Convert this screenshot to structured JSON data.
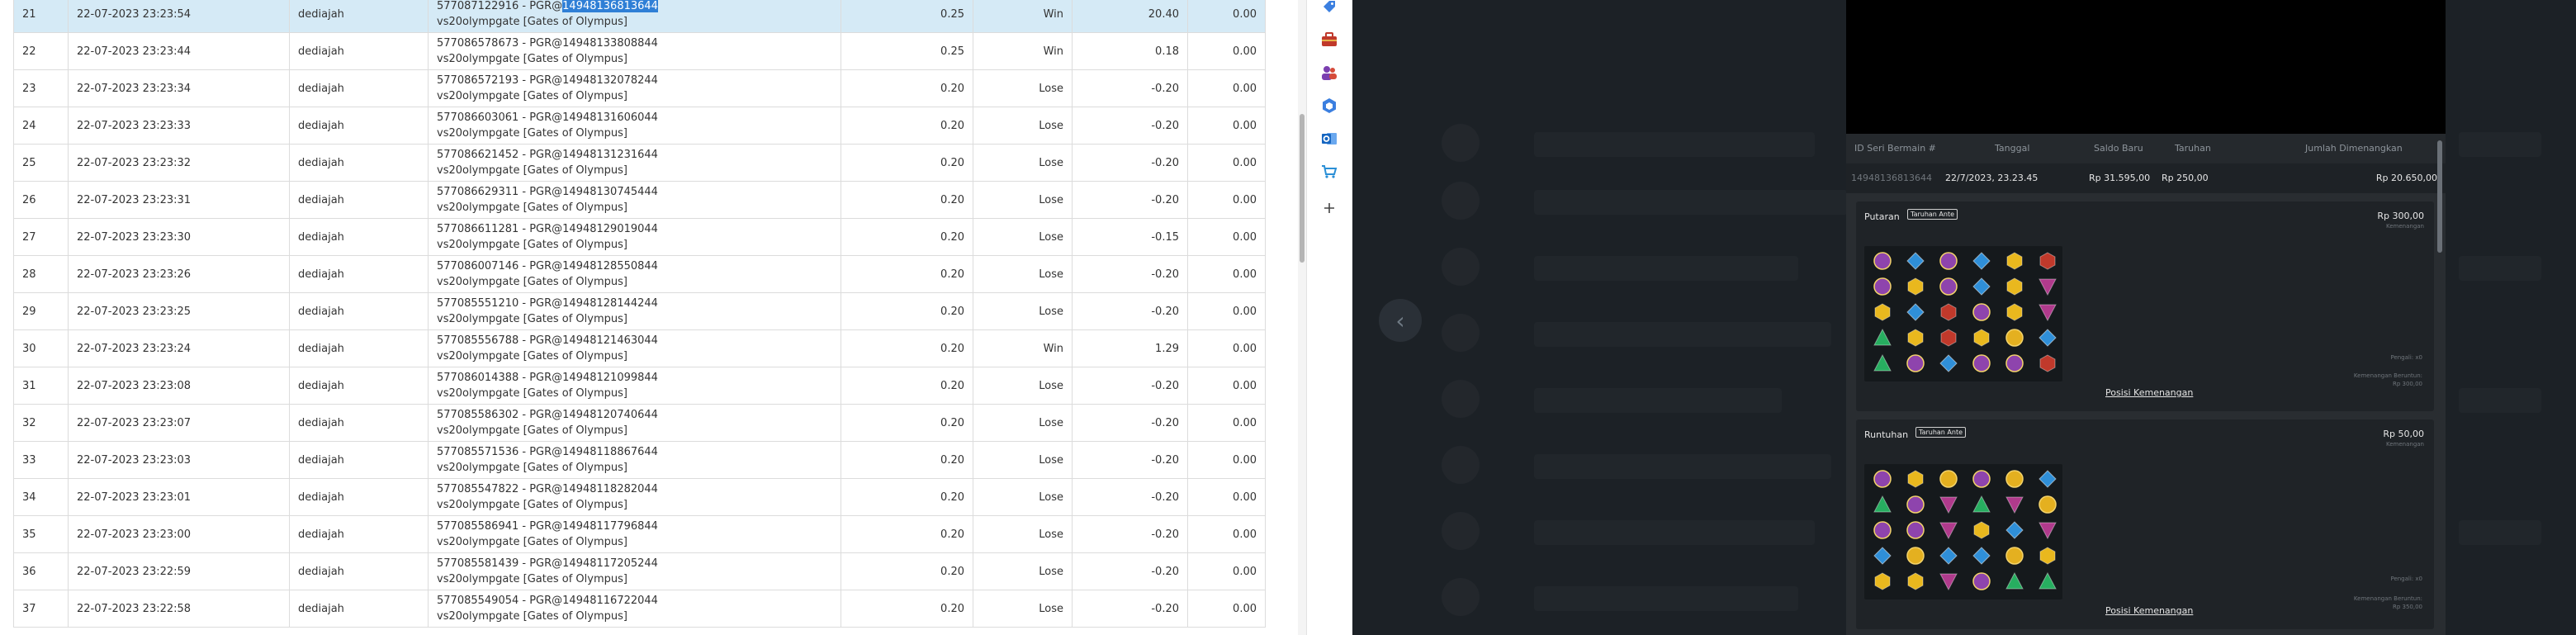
{
  "table": {
    "rows": [
      {
        "no": "21",
        "datetime": "22-07-2023 23:23:54",
        "user": "dediajah",
        "tx_prefix": "577087122916 - PGR@",
        "tx_highlight": "14948136813644",
        "game": "vs20olympgate [Gates of Olympus]",
        "bet": "0.25",
        "result": "Win",
        "win": "20.40",
        "extra": "0.00",
        "selected": true
      },
      {
        "no": "22",
        "datetime": "22-07-2023 23:23:44",
        "user": "dediajah",
        "tx_prefix": "577086578673 - PGR@14948133808844",
        "tx_highlight": "",
        "game": "vs20olympgate [Gates of Olympus]",
        "bet": "0.25",
        "result": "Win",
        "win": "0.18",
        "extra": "0.00"
      },
      {
        "no": "23",
        "datetime": "22-07-2023 23:23:34",
        "user": "dediajah",
        "tx_prefix": "577086572193 - PGR@14948132078244",
        "tx_highlight": "",
        "game": "vs20olympgate [Gates of Olympus]",
        "bet": "0.20",
        "result": "Lose",
        "win": "-0.20",
        "extra": "0.00"
      },
      {
        "no": "24",
        "datetime": "22-07-2023 23:23:33",
        "user": "dediajah",
        "tx_prefix": "577086603061 - PGR@14948131606044",
        "tx_highlight": "",
        "game": "vs20olympgate [Gates of Olympus]",
        "bet": "0.20",
        "result": "Lose",
        "win": "-0.20",
        "extra": "0.00"
      },
      {
        "no": "25",
        "datetime": "22-07-2023 23:23:32",
        "user": "dediajah",
        "tx_prefix": "577086621452 - PGR@14948131231644",
        "tx_highlight": "",
        "game": "vs20olympgate [Gates of Olympus]",
        "bet": "0.20",
        "result": "Lose",
        "win": "-0.20",
        "extra": "0.00"
      },
      {
        "no": "26",
        "datetime": "22-07-2023 23:23:31",
        "user": "dediajah",
        "tx_prefix": "577086629311 - PGR@14948130745444",
        "tx_highlight": "",
        "game": "vs20olympgate [Gates of Olympus]",
        "bet": "0.20",
        "result": "Lose",
        "win": "-0.20",
        "extra": "0.00"
      },
      {
        "no": "27",
        "datetime": "22-07-2023 23:23:30",
        "user": "dediajah",
        "tx_prefix": "577086611281 - PGR@14948129019044",
        "tx_highlight": "",
        "game": "vs20olympgate [Gates of Olympus]",
        "bet": "0.20",
        "result": "Lose",
        "win": "-0.15",
        "extra": "0.00"
      },
      {
        "no": "28",
        "datetime": "22-07-2023 23:23:26",
        "user": "dediajah",
        "tx_prefix": "577086007146 - PGR@14948128550844",
        "tx_highlight": "",
        "game": "vs20olympgate [Gates of Olympus]",
        "bet": "0.20",
        "result": "Lose",
        "win": "-0.20",
        "extra": "0.00"
      },
      {
        "no": "29",
        "datetime": "22-07-2023 23:23:25",
        "user": "dediajah",
        "tx_prefix": "577085551210 - PGR@14948128144244",
        "tx_highlight": "",
        "game": "vs20olympgate [Gates of Olympus]",
        "bet": "0.20",
        "result": "Lose",
        "win": "-0.20",
        "extra": "0.00"
      },
      {
        "no": "30",
        "datetime": "22-07-2023 23:23:24",
        "user": "dediajah",
        "tx_prefix": "577085556788 - PGR@14948121463044",
        "tx_highlight": "",
        "game": "vs20olympgate [Gates of Olympus]",
        "bet": "0.20",
        "result": "Win",
        "win": "1.29",
        "extra": "0.00"
      },
      {
        "no": "31",
        "datetime": "22-07-2023 23:23:08",
        "user": "dediajah",
        "tx_prefix": "577086014388 - PGR@14948121099844",
        "tx_highlight": "",
        "game": "vs20olympgate [Gates of Olympus]",
        "bet": "0.20",
        "result": "Lose",
        "win": "-0.20",
        "extra": "0.00"
      },
      {
        "no": "32",
        "datetime": "22-07-2023 23:23:07",
        "user": "dediajah",
        "tx_prefix": "577085586302 - PGR@14948120740644",
        "tx_highlight": "",
        "game": "vs20olympgate [Gates of Olympus]",
        "bet": "0.20",
        "result": "Lose",
        "win": "-0.20",
        "extra": "0.00"
      },
      {
        "no": "33",
        "datetime": "22-07-2023 23:23:03",
        "user": "dediajah",
        "tx_prefix": "577085571536 - PGR@14948118867644",
        "tx_highlight": "",
        "game": "vs20olympgate [Gates of Olympus]",
        "bet": "0.20",
        "result": "Lose",
        "win": "-0.20",
        "extra": "0.00"
      },
      {
        "no": "34",
        "datetime": "22-07-2023 23:23:01",
        "user": "dediajah",
        "tx_prefix": "577085547822 - PGR@14948118282044",
        "tx_highlight": "",
        "game": "vs20olympgate [Gates of Olympus]",
        "bet": "0.20",
        "result": "Lose",
        "win": "-0.20",
        "extra": "0.00"
      },
      {
        "no": "35",
        "datetime": "22-07-2023 23:23:00",
        "user": "dediajah",
        "tx_prefix": "577085586941 - PGR@14948117796844",
        "tx_highlight": "",
        "game": "vs20olympgate [Gates of Olympus]",
        "bet": "0.20",
        "result": "Lose",
        "win": "-0.20",
        "extra": "0.00"
      },
      {
        "no": "36",
        "datetime": "22-07-2023 23:22:59",
        "user": "dediajah",
        "tx_prefix": "577085581439 - PGR@14948117205244",
        "tx_highlight": "",
        "game": "vs20olympgate [Gates of Olympus]",
        "bet": "0.20",
        "result": "Lose",
        "win": "-0.20",
        "extra": "0.00"
      },
      {
        "no": "37",
        "datetime": "22-07-2023 23:22:58",
        "user": "dediajah",
        "tx_prefix": "577085549054 - PGR@14948116722044",
        "tx_highlight": "",
        "game": "vs20olympgate [Gates of Olympus]",
        "bet": "0.20",
        "result": "Lose",
        "win": "-0.20",
        "extra": "0.00"
      }
    ]
  },
  "sidebar_icons": [
    "tag-icon",
    "toolbox-icon",
    "people-icon",
    "hexagon-icon",
    "outlook-icon",
    "shopping-cart-icon",
    "plus-icon"
  ],
  "viewer": {
    "prev_arrow": "‹",
    "headers": {
      "round_id": "ID Seri Bermain #",
      "date": "Tanggal",
      "balance": "Saldo Baru",
      "bet": "Taruhan",
      "win": "Jumlah Dimenangkan"
    },
    "summary": {
      "round_id": "14948136813644",
      "date": "22/7/2023, 23.23.45",
      "balance": "Rp 31.595,00",
      "bet": "Rp 250,00",
      "win": "Rp 20.650,00"
    },
    "sections": [
      {
        "title": "Putaran",
        "badge": "Taruhan Ante",
        "amount": "Rp 300,00",
        "amount_sub": "Kemenangan",
        "note1": "Pengali: x0",
        "note2": "Kemenangan Beruntun:",
        "note3": "Rp 300,00",
        "link": "Posisi Kemenangan"
      },
      {
        "title": "Runtuhan",
        "badge": "Taruhan Ante",
        "amount": "Rp 50,00",
        "amount_sub": "Kemenangan",
        "note1": "Pengali: x0",
        "note2": "Kemenangan Beruntun:",
        "note3": "Rp 350,00",
        "link": "Posisi Kemenangan"
      }
    ]
  },
  "colors": {
    "win": "#2e8b2e",
    "lose": "#e2231a",
    "selected_row": "#d5eaf6",
    "highlight": "#2f7fd6",
    "viewer_bg": "#1c2126"
  }
}
